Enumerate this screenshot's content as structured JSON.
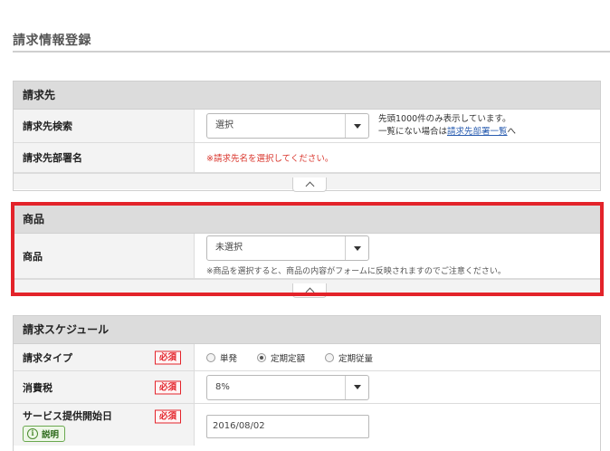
{
  "page": {
    "title": "請求情報登録"
  },
  "billing_section": {
    "title": "請求先",
    "search_label": "請求先検索",
    "search_select_value": "選択",
    "hint_line1": "先頭1000件のみ表示しています。",
    "hint_line2_prefix": "一覧にない場合は",
    "hint_link": "請求先部署一覧",
    "hint_line2_suffix": "へ",
    "dept_label": "請求先部署名",
    "dept_error": "※請求先名を選択してください。"
  },
  "product_section": {
    "title": "商品",
    "product_label": "商品",
    "product_select_value": "未選択",
    "product_note": "※商品を選択すると、商品の内容がフォームに反映されますのでご注意ください。"
  },
  "schedule_section": {
    "title": "請求スケジュール",
    "required_badge": "必須",
    "type_label": "請求タイプ",
    "type_options": [
      "単発",
      "定期定額",
      "定期従量"
    ],
    "type_selected": "定期定額",
    "tax_label": "消費税",
    "tax_value": "8%",
    "start_label": "サービス提供開始日",
    "start_value": "2016/08/02",
    "explain_label": "説明"
  },
  "colors": {
    "highlight": "#e3232a",
    "required": "#e3232a",
    "link": "#2a5db0",
    "error": "#d9342b"
  }
}
